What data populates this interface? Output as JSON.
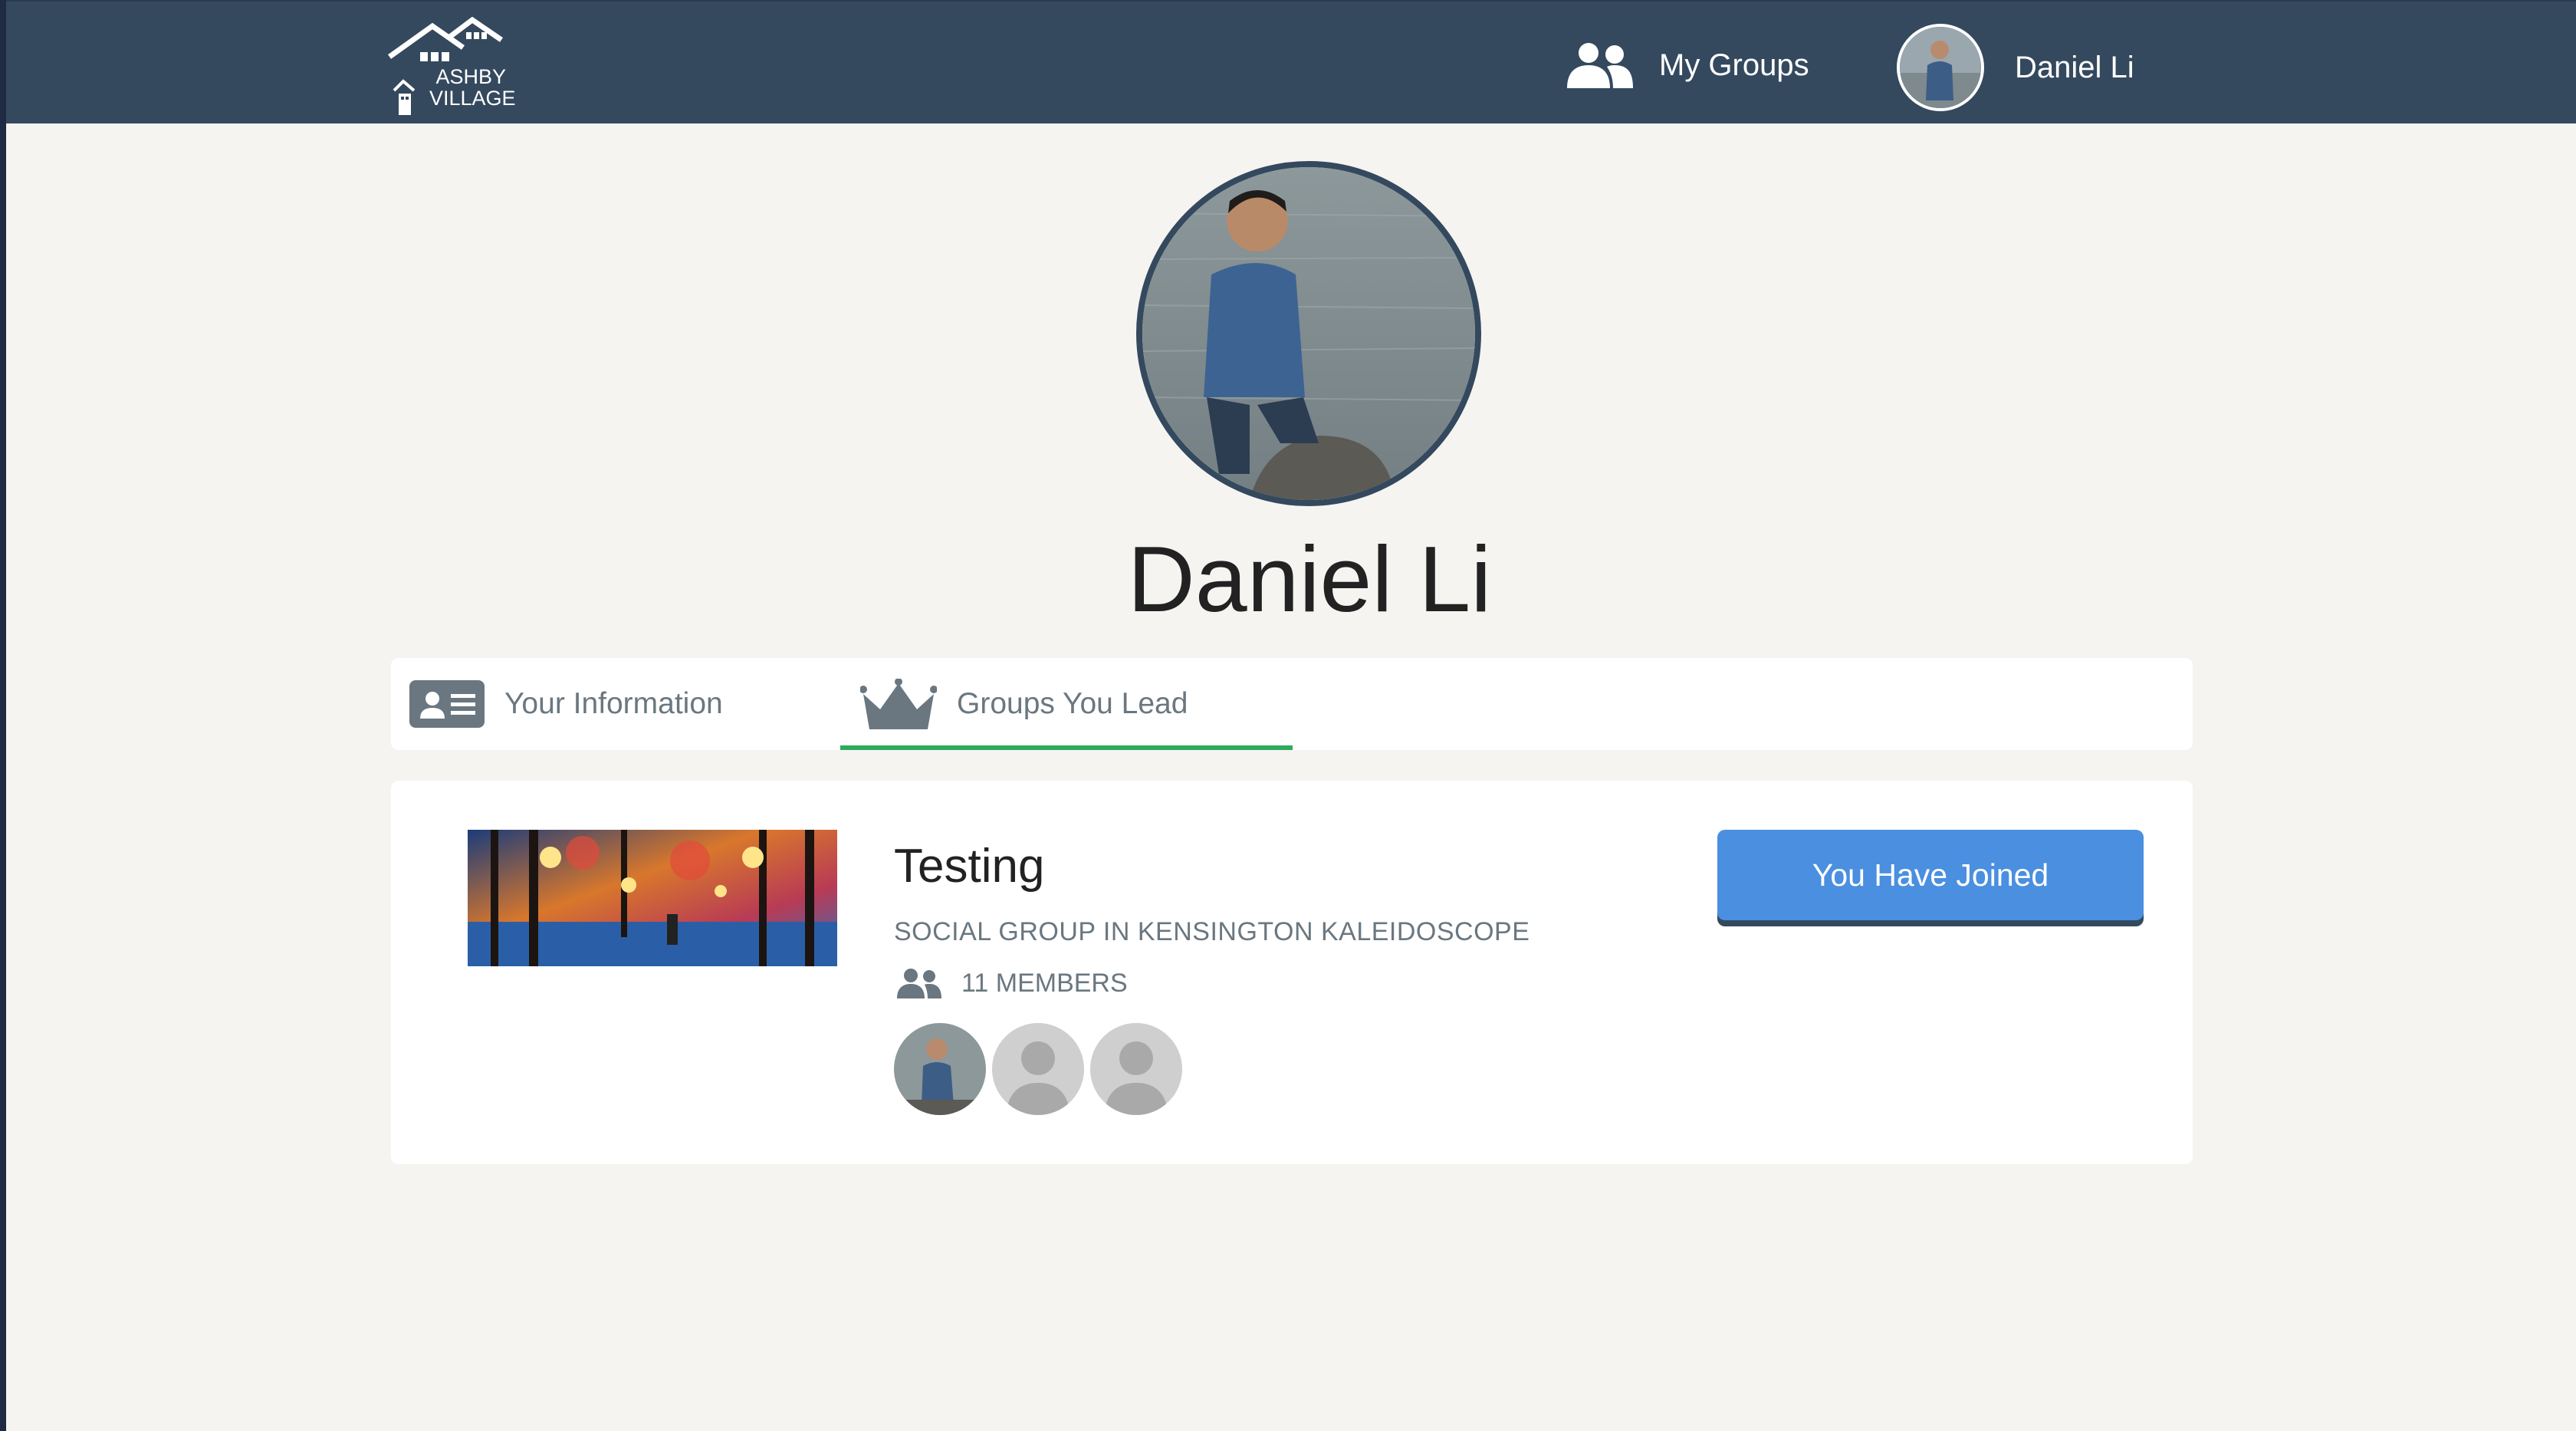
{
  "header": {
    "logo_line1": "ASHBY",
    "logo_line2": "VILLAGE",
    "my_groups_label": "My Groups",
    "user_name": "Daniel Li",
    "bar_color": "#34495e"
  },
  "profile": {
    "name": "Daniel Li"
  },
  "tabs": [
    {
      "label": "Your Information",
      "icon": "id-card-icon",
      "active": false
    },
    {
      "label": "Groups You Lead",
      "icon": "crown-icon",
      "active": true
    }
  ],
  "group": {
    "title": "Testing",
    "subtitle": "SOCIAL GROUP IN KENSINGTON KALEIDOSCOPE",
    "members_label": "11 MEMBERS",
    "button_label": "You Have Joined",
    "accent_color": "#4a8fe0",
    "tab_underline_color": "#2eaa5c"
  }
}
